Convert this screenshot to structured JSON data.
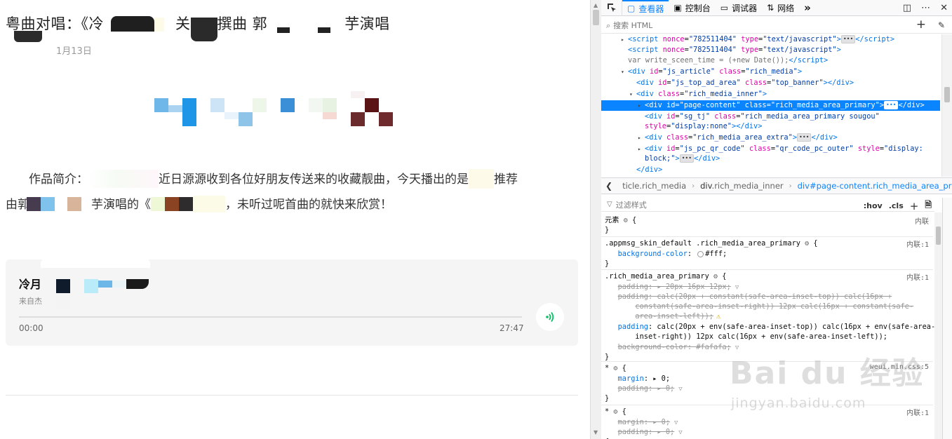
{
  "article": {
    "title_parts": [
      "粤曲对唱：《冷",
      "关",
      "撰曲 郭",
      "芋演唱"
    ],
    "date": "1月13日",
    "intro_parts": [
      "作品简介：",
      "近日源源收到各位好朋友传送来的收藏靓曲，今天播出的是",
      "推荐",
      "由郭",
      "芋演唱的《",
      "，未听过呢首曲的就快来欣赏！"
    ],
    "audio": {
      "title": "冷月",
      "source": "来自杰",
      "time_start": "00:00",
      "time_end": "27:47",
      "progress": 0
    }
  },
  "devtools": {
    "tabs": [
      {
        "label": "查看器",
        "icon": "▢"
      },
      {
        "label": "控制台",
        "icon": "▣"
      },
      {
        "label": "调试器",
        "icon": "▭"
      },
      {
        "label": "网络",
        "icon": "⇅"
      }
    ],
    "more_tabs": "»",
    "search_placeholder": "搜索 HTML",
    "markup_lines": [
      {
        "html": "<span class='tw'>▸</span><span class='tg'>&lt;script</span> <span class='at'>nonce</span>=<span class='av'>\"782511404\"</span> <span class='at'>type</span>=<span class='av'>\"text/javascript\"</span><span class='tg'>&gt;</span><span class='badge'>•••</span><span class='tg'>&lt;/script&gt;</span>"
      },
      {
        "html": "<span class='tw'></span><span class='tg'>&lt;script</span> <span class='at'>nonce</span>=<span class='av'>\"782511404\"</span> <span class='at'>type</span>=<span class='av'>\"text/javascript\"</span><span class='tg'>&gt;</span>"
      },
      {
        "html": "<span class='tw'></span><span class='cm'>var write_sceen_time = (+new Date());</span><span class='tg'>&lt;/script&gt;</span>"
      },
      {
        "html": "<span class='tw'>▾</span><span class='tg'>&lt;div</span> <span class='at'>id</span>=<span class='av'>\"js_article\"</span> <span class='at'>class</span>=<span class='av'>\"rich_media\"</span><span class='tg'>&gt;</span>"
      },
      {
        "html": "<span class='tw'></span><span class='tg'>&lt;div</span> <span class='at'>id</span>=<span class='av'>\"js_top_ad_area\"</span> <span class='at'>class</span>=<span class='av'>\"top_banner\"</span><span class='tg'>&gt;&lt;/div&gt;</span>"
      },
      {
        "html": "<span class='tw'>▾</span><span class='tg'>&lt;div</span> <span class='at'>class</span>=<span class='av'>\"rich_media_inner\"</span><span class='tg'>&gt;</span>"
      },
      {
        "html": "<span class='tw'>▸</span><span class='tg'>&lt;div</span> <span class='at'>id</span>=<span class='av'>\"page-content\"</span> <span class='at'>class</span>=<span class='av'>\"rich_media_area_primary\"</span><span class='tg'>&gt;</span><span class='badge'>•••</span><span class='tg'>&lt;/div&gt;</span>"
      },
      {
        "html": "<span class='tw'></span><span class='tg'>&lt;div</span> <span class='at'>id</span>=<span class='av'>\"sg_tj\"</span> <span class='at'>class</span>=<span class='av'>\"rich_media_area_primary sougou\"</span>"
      },
      {
        "html": "<span class='tw'></span><span class='at'>style</span>=<span class='av'>\"display:none\"</span><span class='tg'>&gt;&lt;/div&gt;</span>"
      },
      {
        "html": "<span class='tw'>▸</span><span class='tg'>&lt;div</span> <span class='at'>class</span>=<span class='av'>\"rich_media_area_extra\"</span><span class='tg'>&gt;</span><span class='badge'>•••</span><span class='tg'>&lt;/div&gt;</span>"
      },
      {
        "html": "<span class='tw'>▸</span><span class='tg'>&lt;div</span> <span class='at'>id</span>=<span class='av'>\"js_pc_qr_code\"</span> <span class='at'>class</span>=<span class='av'>\"qr_code_pc_outer\"</span> <span class='at'>style</span>=<span class='av'>\"display:</span>"
      },
      {
        "html": "<span class='tw'></span><span class='av'>block;\"</span><span class='tg'>&gt;</span><span class='badge'>•••</span><span class='tg'>&lt;/div&gt;</span>"
      },
      {
        "html": "<span class='tw'></span><span class='tg'>&lt;/div&gt;</span>"
      }
    ],
    "breadcrumbs": [
      {
        "tag": "",
        "cls": "ticle.rich_media"
      },
      {
        "tag": "div",
        "cls": ".rich_media_inner"
      },
      {
        "tag": "div",
        "cls": "#page-content.rich_media_area_primary"
      }
    ],
    "filter_placeholder": "过滤样式",
    "filter_tools": [
      ":hov",
      ".cls"
    ],
    "rules": [
      {
        "lines": [
          "元素 <span class='gear'>⚙</span> {",
          "}"
        ],
        "source": "内联"
      },
      {
        "lines": [
          ".appmsg_skin_default .rich_media_area_primary <span class='gear'>⚙</span> {",
          "&nbsp;&nbsp;&nbsp;<span class='pn'>background-color</span>: <span class='ck'></span><span class='pv'>#fff</span>;",
          "}"
        ],
        "source": "内联:1"
      },
      {
        "lines": [
          ".rich_media_area_primary <span class='gear'>⚙</span> {",
          "&nbsp;&nbsp;&nbsp;<span class='strike'><span class='pn'>padding</span>: ▸ <span class='pv'>20px 16px 12px</span>;</span><span class='funnel'>▽</span>",
          "&nbsp;&nbsp;&nbsp;<span class='strike'><span class='pn'>padding</span>: <span class='pv'>calc(20px + constant(safe-area-inset-top)) calc(16px +</span></span>",
          "&nbsp;&nbsp;&nbsp;&nbsp;&nbsp;&nbsp;&nbsp;<span class='strike'><span class='pv'>constant(safe-area-inset-right)) 12px calc(16px + constant(safe-</span></span>",
          "&nbsp;&nbsp;&nbsp;&nbsp;&nbsp;&nbsp;&nbsp;<span class='strike'><span class='pv'>area-inset-left))</span>;</span><span class='warn'>⚠</span>",
          "&nbsp;&nbsp;&nbsp;<span class='pn'>padding</span>: <span class='pv'>calc(20px + env(safe-area-inset-top)) calc(16px + env(safe-area-</span>",
          "&nbsp;&nbsp;&nbsp;&nbsp;&nbsp;&nbsp;&nbsp;<span class='pv'>inset-right)) 12px calc(16px + env(safe-area-inset-left))</span>;",
          "&nbsp;&nbsp;&nbsp;<span class='strike'><span class='pn'>background-color</span>: <span class='pv'>#fafafa</span>;</span><span class='funnel'>▽</span>",
          "}"
        ],
        "source": "内联:1"
      },
      {
        "lines": [
          "* <span class='gear'>⚙</span> {",
          "&nbsp;&nbsp;&nbsp;<span class='pn'>margin</span>: ▸ <span class='pv'>0</span>;",
          "&nbsp;&nbsp;&nbsp;<span class='strike'><span class='pn'>padding</span>: ▸ <span class='pv'>0</span>;</span><span class='funnel'>▽</span>",
          "}"
        ],
        "source": "weui.min.css:5"
      },
      {
        "lines": [
          "* <span class='gear'>⚙</span> {",
          "&nbsp;&nbsp;&nbsp;<span class='strike'><span class='pn'>margin</span>: ▸ <span class='pv'>0</span>;</span><span class='funnel'>▽</span>",
          "&nbsp;&nbsp;&nbsp;<span class='strike'><span class='pn'>padding</span>: ▸ <span class='pv'>0</span>;</span><span class='funnel'>▽</span>",
          "{"
        ],
        "source": "内联:1"
      }
    ]
  },
  "watermark": {
    "brand": "Bai du 经验",
    "url": "jingyan.baidu.com"
  },
  "colors": {
    "accent": "#0a84ff",
    "selected_row": "#0a84ff",
    "tag": "#0074e8",
    "attr": "#dd00a9",
    "attr_value": "#003eaa"
  }
}
